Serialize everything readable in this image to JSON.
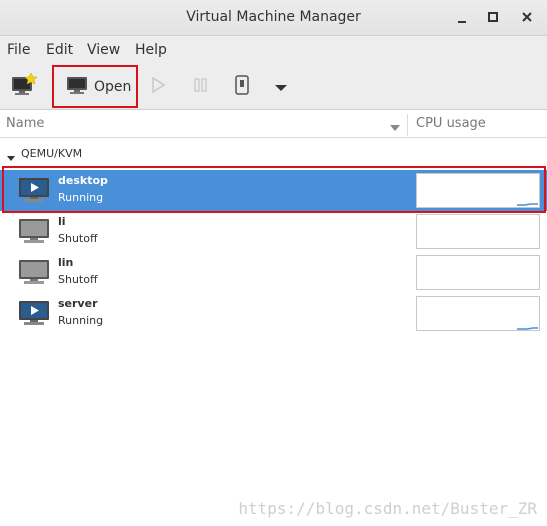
{
  "window": {
    "title": "Virtual Machine Manager",
    "controls": [
      "minimize-icon",
      "maximize-icon",
      "close-icon"
    ]
  },
  "menubar": {
    "items": [
      "File",
      "Edit",
      "View",
      "Help"
    ]
  },
  "toolbar": {
    "new_icon": "new-vm-icon",
    "open_label": "Open",
    "run_icon": "play-icon",
    "pause_icon": "pause-icon",
    "shutdown_icon": "shutdown-icon",
    "menu_icon": "dropdown-arrow-icon"
  },
  "columns": {
    "name": "Name",
    "cpu": "CPU usage"
  },
  "group": {
    "label": "QEMU/KVM",
    "expanded": true
  },
  "vms": [
    {
      "name": "desktop",
      "status": "Running",
      "state": "running",
      "selected": true,
      "cpu_spark": [
        0.05,
        0.05,
        0.05,
        0.08,
        0.08
      ]
    },
    {
      "name": "li",
      "status": "Shutoff",
      "state": "shutoff",
      "selected": false,
      "cpu_spark": []
    },
    {
      "name": "lin",
      "status": "Shutoff",
      "state": "shutoff",
      "selected": false,
      "cpu_spark": []
    },
    {
      "name": "server",
      "status": "Running",
      "state": "running",
      "selected": false,
      "cpu_spark": [
        0.05,
        0.05,
        0.08,
        0.08
      ]
    }
  ],
  "watermark": "https://blog.csdn.net/Buster_ZR",
  "colors": {
    "selection": "#4a90d9",
    "highlight_box": "#d6131b",
    "graph_line": "#4a90d9"
  }
}
